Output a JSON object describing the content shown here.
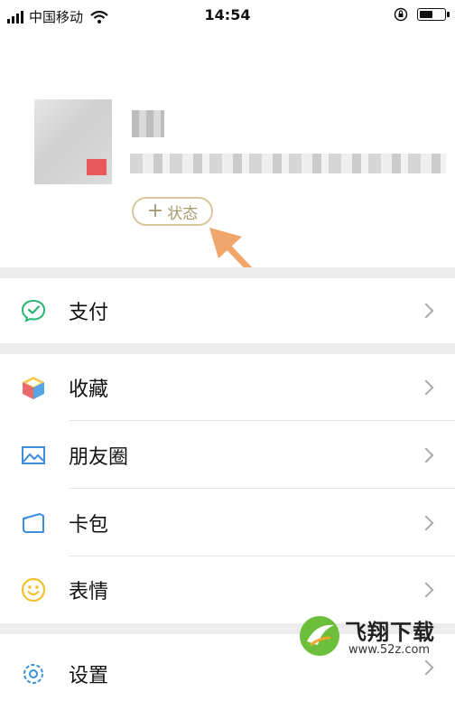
{
  "status_bar": {
    "carrier": "中国移动",
    "time": "14:54",
    "battery_level": 0.55
  },
  "profile": {
    "status_button": {
      "plus": "+",
      "label": "状态"
    }
  },
  "menu": {
    "pay": {
      "label": "支付",
      "icon": "wechat-pay-icon"
    },
    "favorites": {
      "label": "收藏",
      "icon": "cube-icon"
    },
    "moments": {
      "label": "朋友圈",
      "icon": "picture-icon"
    },
    "cards": {
      "label": "卡包",
      "icon": "card-wallet-icon"
    },
    "stickers": {
      "label": "表情",
      "icon": "smiley-icon"
    },
    "settings": {
      "label": "设置",
      "icon": "gear-icon"
    }
  },
  "watermark": {
    "brand": "飞翔下载",
    "url": "www.52z.com"
  },
  "colors": {
    "accent_arrow": "#f0a56a",
    "status_border": "#d8c79a",
    "separator": "#ececec"
  }
}
